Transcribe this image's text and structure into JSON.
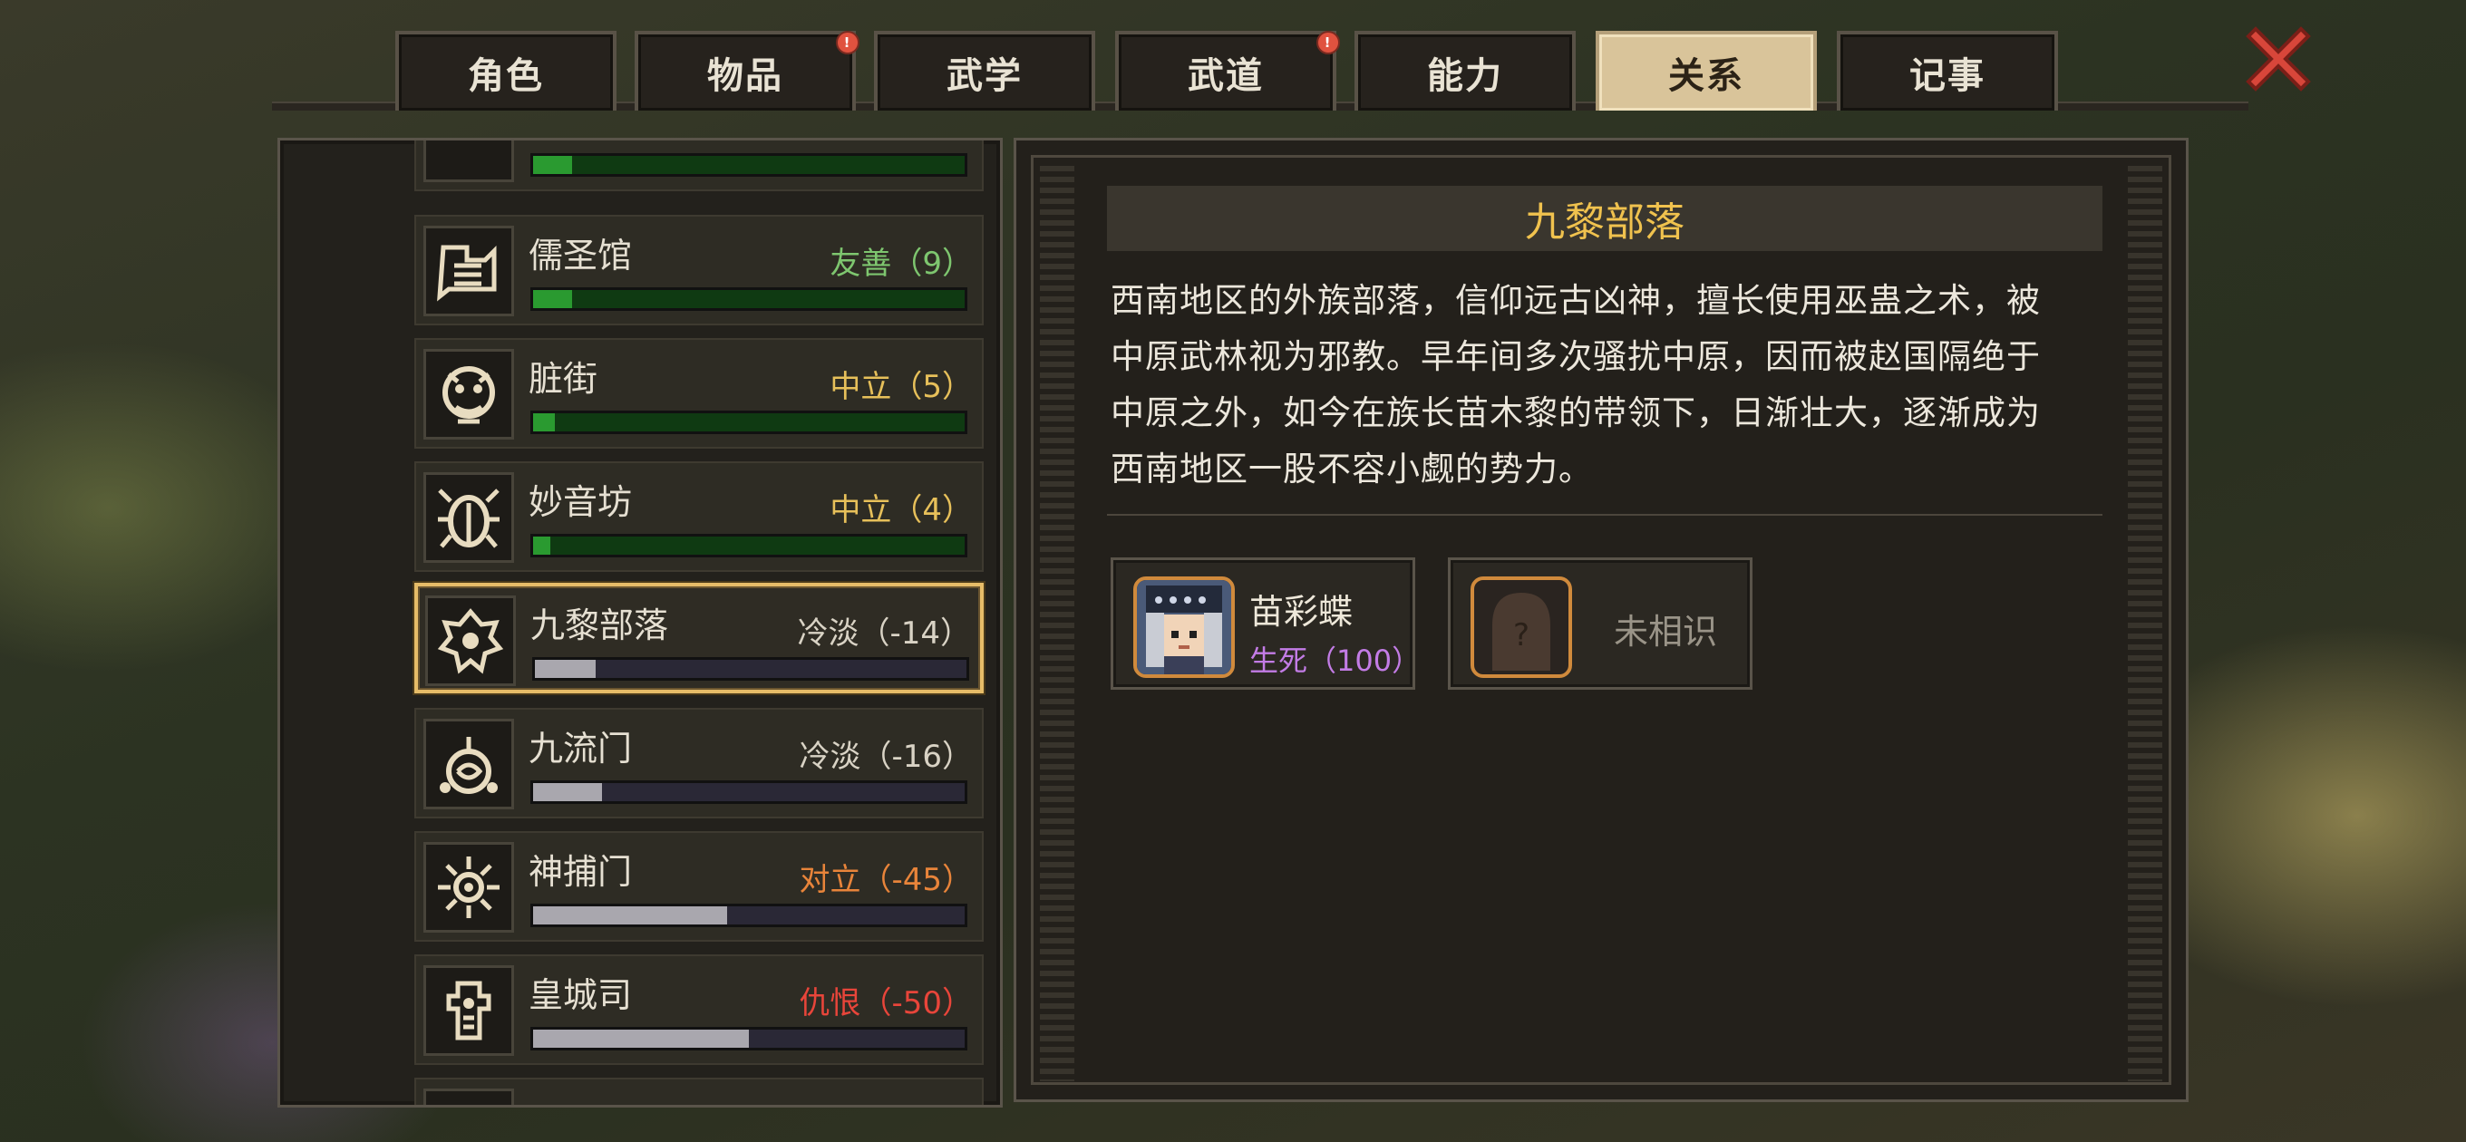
{
  "tabs": [
    {
      "label": "角色",
      "badge": false
    },
    {
      "label": "物品",
      "badge": true
    },
    {
      "label": "武学",
      "badge": false
    },
    {
      "label": "武道",
      "badge": true
    },
    {
      "label": "能力",
      "badge": false
    },
    {
      "label": "关系",
      "badge": false,
      "active": true
    },
    {
      "label": "记事",
      "badge": false
    }
  ],
  "badge_text": "!",
  "factions": [
    {
      "name": "儒圣馆",
      "status": "友善（9）",
      "level": 9,
      "color": "#7ec66f",
      "bar": "green"
    },
    {
      "name": "脏街",
      "status": "中立（5）",
      "level": 5,
      "color": "#e7c05a",
      "bar": "green"
    },
    {
      "name": "妙音坊",
      "status": "中立（4）",
      "level": 4,
      "color": "#e7c05a",
      "bar": "green"
    },
    {
      "name": "九黎部落",
      "status": "冷淡（-14）",
      "level": -14,
      "color": "#d9d3c5",
      "bar": "gray",
      "selected": true
    },
    {
      "name": "九流门",
      "status": "冷淡（-16）",
      "level": -16,
      "color": "#d9d3c5",
      "bar": "gray"
    },
    {
      "name": "神捕门",
      "status": "对立（-45）",
      "level": -45,
      "color": "#e8843a",
      "bar": "gray"
    },
    {
      "name": "皇城司",
      "status": "仇恨（-50）",
      "level": -50,
      "color": "#e8453a",
      "bar": "gray"
    }
  ],
  "detail": {
    "title": "九黎部落",
    "description_lines": [
      "西南地区的外族部落，信仰远古凶神，擅长使用巫蛊之术，被",
      "中原武林视为邪教。早年间多次骚扰中原，因而被赵国隔绝于",
      "中原之外，如今在族长苗木黎的带领下，日渐壮大，逐渐成为",
      "西南地区一股不容小觑的势力。"
    ],
    "members": [
      {
        "name": "苗彩蝶",
        "relation": "生死（100）"
      },
      {
        "unknown_label": "未相识"
      }
    ]
  }
}
